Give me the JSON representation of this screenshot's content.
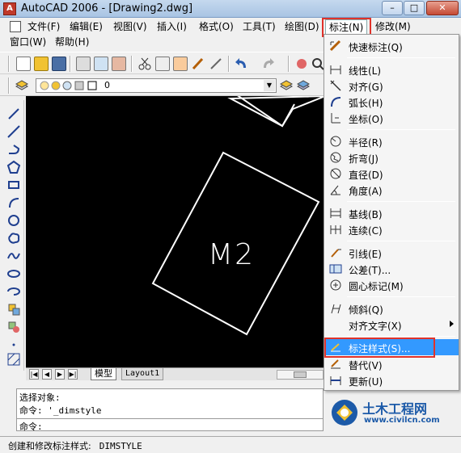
{
  "window": {
    "title": "AutoCAD 2006 - [Drawing2.dwg]",
    "app_icon_letter": "A",
    "minimize": "–",
    "maximize": "□",
    "close": "✕"
  },
  "menubar": {
    "row1": [
      "文件(F)",
      "编辑(E)",
      "视图(V)",
      "插入(I)",
      "格式(O)",
      "工具(T)",
      "绘图(D)",
      "标注(N)",
      "修改(M)"
    ],
    "row2": [
      "窗口(W)",
      "帮助(H)"
    ],
    "active_menu": "标注(N)",
    "doc_controls": [
      "–",
      "□",
      "✕"
    ]
  },
  "layer_toolbar": {
    "current_layer": "0"
  },
  "drawing": {
    "label": "M2",
    "background": "#000000",
    "line_color": "#ffffff"
  },
  "tabs": {
    "nav": [
      "|◀",
      "◀",
      "▶",
      "▶|"
    ],
    "model": "模型",
    "layout": "Layout1"
  },
  "command": {
    "history": [
      "选择对象:",
      "命令: '_dimstyle"
    ],
    "prompt": "命令:"
  },
  "status": {
    "text": "创建和修改标注样式:",
    "command": "DIMSTYLE"
  },
  "dimension_menu": {
    "items": [
      {
        "label": "快速标注(Q)",
        "icon": "quick-dimension-icon"
      },
      {
        "label": "线性(L)",
        "icon": "linear-dimension-icon"
      },
      {
        "label": "对齐(G)",
        "icon": "aligned-dimension-icon"
      },
      {
        "label": "弧长(H)",
        "icon": "arc-length-icon"
      },
      {
        "label": "坐标(O)",
        "icon": "ordinate-icon"
      },
      {
        "label": "半径(R)",
        "icon": "radius-icon"
      },
      {
        "label": "折弯(J)",
        "icon": "jogged-icon"
      },
      {
        "label": "直径(D)",
        "icon": "diameter-icon"
      },
      {
        "label": "角度(A)",
        "icon": "angular-icon"
      },
      {
        "label": "基线(B)",
        "icon": "baseline-icon"
      },
      {
        "label": "连续(C)",
        "icon": "continue-icon"
      },
      {
        "label": "引线(E)",
        "icon": "leader-icon"
      },
      {
        "label": "公差(T)...",
        "icon": "tolerance-icon"
      },
      {
        "label": "圆心标记(M)",
        "icon": "center-mark-icon"
      },
      {
        "label": "倾斜(Q)",
        "icon": "oblique-icon"
      },
      {
        "label": "对齐文字(X)",
        "icon": ""
      },
      {
        "label": "标注样式(S)...",
        "icon": "dimension-style-icon"
      },
      {
        "label": "替代(V)",
        "icon": "override-icon"
      },
      {
        "label": "更新(U)",
        "icon": "update-icon"
      }
    ],
    "highlighted": "标注样式(S)...",
    "highlight_color": "#3399ff",
    "callout_color": "#e0322a"
  },
  "watermark": {
    "title": "土木工程网",
    "url": "www.civilcn.com",
    "color": "#1c5aa8"
  }
}
